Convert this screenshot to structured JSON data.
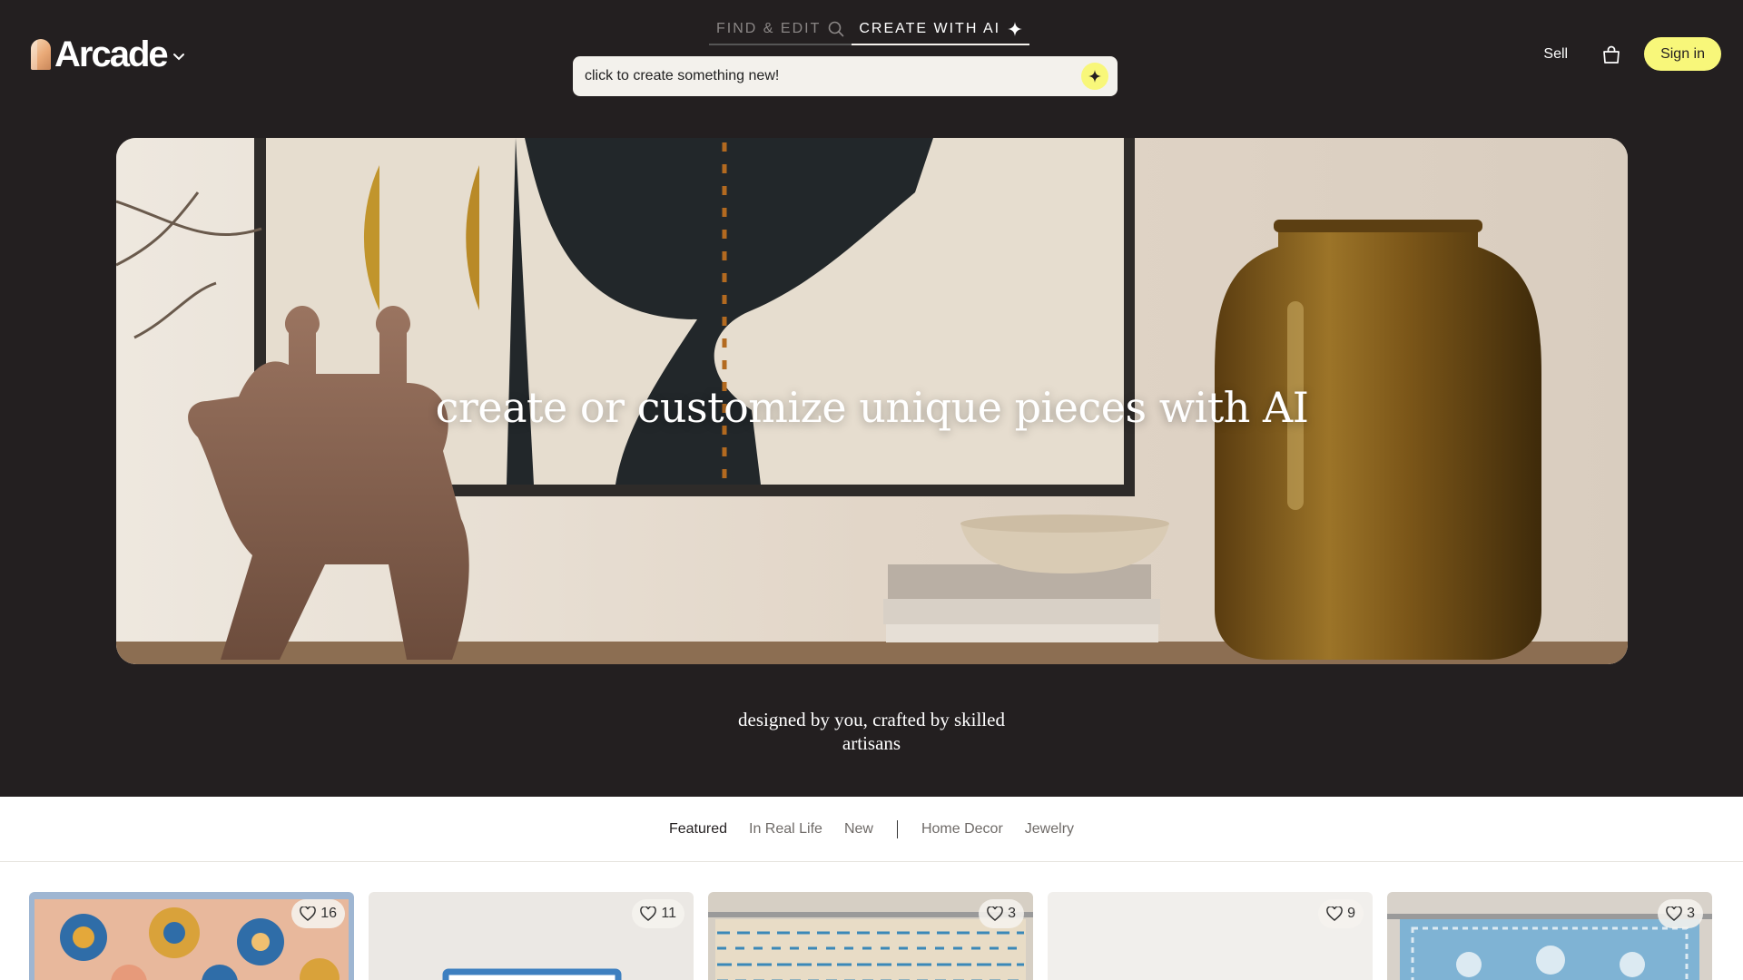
{
  "brand": {
    "name": "Arcade"
  },
  "header": {
    "tabs": [
      {
        "label": "FIND & EDIT",
        "icon": "search-icon",
        "active": false
      },
      {
        "label": "CREATE WITH AI",
        "icon": "sparkle-icon",
        "active": true
      }
    ],
    "create_input": {
      "placeholder": "click to create something new!"
    },
    "sell_label": "Sell",
    "cart_icon": "shopping-bag-icon",
    "signin_label": "Sign in"
  },
  "hero": {
    "title": "create or customize unique pieces with AI",
    "tagline_line1": "designed by you, crafted by skilled",
    "tagline_line2": "artisans"
  },
  "filters": [
    "Featured",
    "In Real Life",
    "New",
    "Home Decor",
    "Jewelry"
  ],
  "products": [
    {
      "likes": "16"
    },
    {
      "likes": "11"
    },
    {
      "likes": "3"
    },
    {
      "likes": "9"
    },
    {
      "likes": "3"
    }
  ],
  "colors": {
    "background": "#231f20",
    "accent": "#f8f77a",
    "light": "#f3f1ec"
  }
}
